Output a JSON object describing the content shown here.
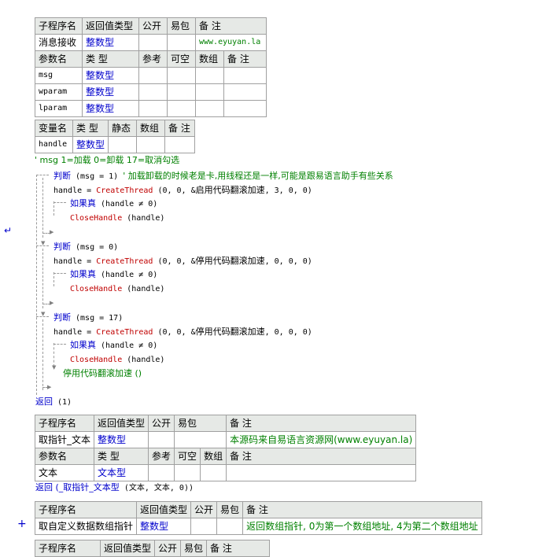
{
  "t1": {
    "head": [
      "子程序名",
      "返回值类型",
      "公开",
      "易包",
      "备 注"
    ],
    "row": [
      "消息接收",
      "整数型",
      "",
      "",
      "www.eyuyan.la"
    ],
    "param_head": [
      "参数名",
      "类 型",
      "参考",
      "可空",
      "数组",
      "备 注"
    ],
    "params": [
      [
        "msg",
        "整数型"
      ],
      [
        "wparam",
        "整数型"
      ],
      [
        "lparam",
        "整数型"
      ]
    ]
  },
  "vars": {
    "head": [
      "变量名",
      "类 型",
      "静态",
      "数组",
      "备 注"
    ],
    "rows": [
      [
        "handle",
        "整数型"
      ]
    ]
  },
  "code": {
    "comment1": "' msg  1=加载 0=卸载 17=取消勾选",
    "j1_kw": "判断",
    "j1_cond": " (msg = 1) ",
    "j1_comment": " ' 加载卸载的时候老是卡,用线程还是一样,可能是跟易语言助手有些关系",
    "j2_kw": "判断",
    "j2_cond": " (msg = 0)",
    "j3_kw": "判断",
    "j3_cond": " (msg = 17)",
    "handle_eq": "handle = ",
    "create_thread": "CreateThread",
    "args_open": " (0, 0, &",
    "fn_enable": "启用代码翻滚加速",
    "fn_disable": "停用代码翻滚加速",
    "args_1": ", 3, 0, 0)",
    "args_2": ", 0, 0, 0)",
    "if_kw": "如果真",
    "if_cond": " (handle ≠ 0)",
    "close_handle": "CloseHandle",
    "close_args": " (handle)",
    "stop_call": "停用代码翻滚加速 ()",
    "return_kw": "返回",
    "return_val": " (1)",
    "return2_kw": "返回",
    "return2_fn": " (_取指针_文本型",
    "return2_args": " (文本, 文本, 0))"
  },
  "t2": {
    "head": [
      "子程序名",
      "返回值类型",
      "公开",
      "易包",
      "备 注"
    ],
    "row": [
      "取指针_文本",
      "整数型",
      "",
      "",
      "本源码来自易语言资源网(www.eyuyan.la)"
    ],
    "param_head": [
      "参数名",
      "类 型",
      "参考",
      "可空",
      "数组",
      "备 注"
    ],
    "params": [
      [
        "文本",
        "文本型"
      ]
    ]
  },
  "t3": {
    "head": [
      "子程序名",
      "返回值类型",
      "公开",
      "易包",
      "备 注"
    ],
    "row": [
      "取自定义数据数组指针",
      "整数型",
      "",
      "",
      "返回数组指针, 0为第一个数组地址, 4为第二个数组地址"
    ]
  },
  "t4": {
    "head": [
      "子程序名",
      "返回值类型",
      "公开",
      "易包",
      "备 注"
    ]
  },
  "gutter": {
    "expand_symbol": "+",
    "marker_symbol": "↵"
  }
}
